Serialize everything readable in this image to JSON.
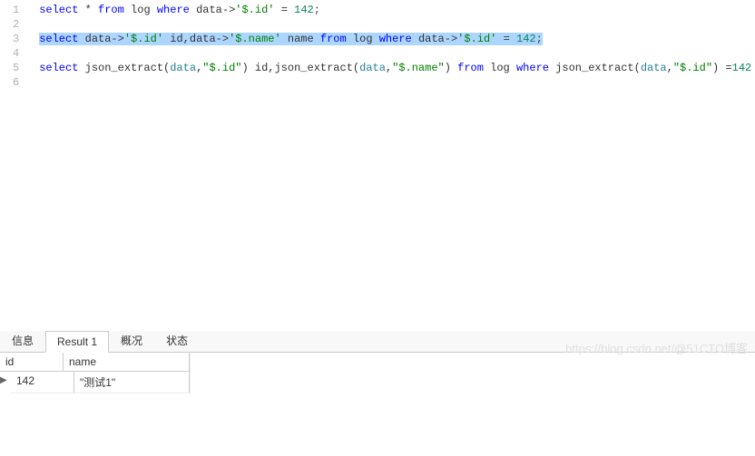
{
  "editor": {
    "lines": [
      1,
      2,
      3,
      4,
      5,
      6
    ],
    "l1": {
      "select": "select",
      "star": " * ",
      "from": "from",
      "log": " log ",
      "where": "where",
      "data": " data->",
      "path": "'$.id'",
      "eq": " = ",
      "num": "142",
      "semi": ";"
    },
    "l3": {
      "select": "select",
      "sp1": " data->",
      "path1": "'$.id'",
      "alias1": " id,data->",
      "path2": "'$.name'",
      "alias2": " name ",
      "from": "from",
      "log": " log ",
      "where": "where",
      "data": " data->",
      "path3": "'$.id'",
      "eq": " = ",
      "num": "142",
      "semi": ";"
    },
    "l5": {
      "select": "select",
      "sp1": " json_extract(",
      "d1": "data",
      "c1": ",",
      "s1": "\"$.id\"",
      "p1": ") id,json_extract(",
      "d2": "data",
      "c2": ",",
      "s2": "\"$.name\"",
      "p2": ") ",
      "from": "from",
      "log": " log ",
      "where": "where",
      "sp2": " json_extract(",
      "d3": "data",
      "c3": ",",
      "s3": "\"$.id\"",
      "p3": ") =",
      "num": "142"
    }
  },
  "watermark": "https://blog.csdn.net/@51CTO博客",
  "tabs": {
    "t1": "信息",
    "t2": "Result 1",
    "t3": "概况",
    "t4": "状态"
  },
  "result": {
    "columns": {
      "c1": "id",
      "c2": "name"
    },
    "row": {
      "c1": "142",
      "c2": "\"测试1\""
    },
    "marker": "▶"
  }
}
